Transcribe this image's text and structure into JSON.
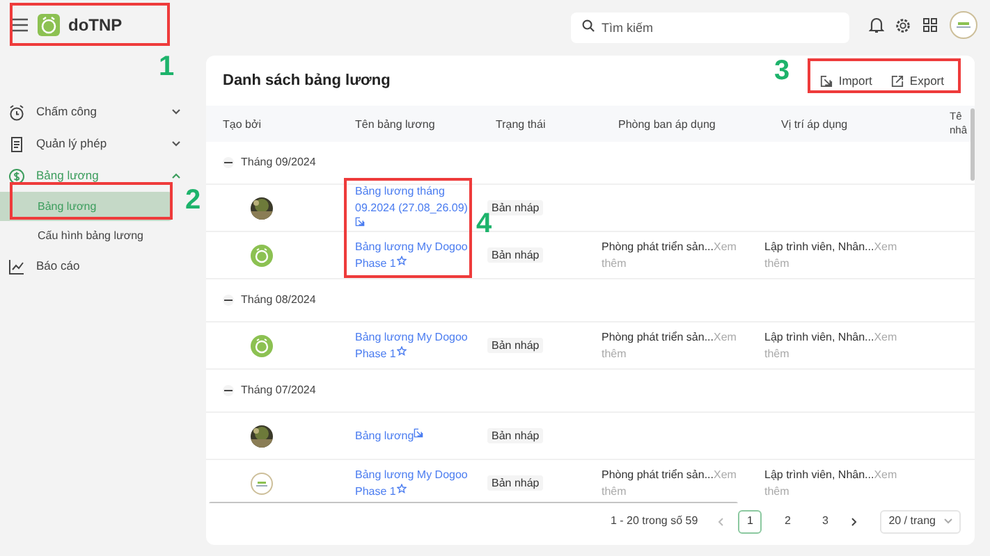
{
  "app": {
    "name": "doTNP"
  },
  "search": {
    "placeholder": "Tìm kiếm"
  },
  "sidebar": {
    "items": [
      {
        "label": "Chấm công",
        "kind": "clock",
        "expanded": false
      },
      {
        "label": "Quản lý phép",
        "kind": "document",
        "expanded": false
      },
      {
        "label": "Bảng lương",
        "kind": "dollar",
        "expanded": true,
        "children": [
          {
            "label": "Bảng lương",
            "selected": true
          },
          {
            "label": "Cấu hình bảng lương",
            "selected": false
          }
        ]
      },
      {
        "label": "Báo cáo",
        "kind": "chart"
      }
    ]
  },
  "panel": {
    "title": "Danh sách bảng lương",
    "actions": [
      {
        "label": "Import",
        "kind": "import"
      },
      {
        "label": "Export",
        "kind": "export"
      }
    ]
  },
  "table": {
    "columns": [
      "Tạo bởi",
      "Tên bảng lương",
      "Trạng thái",
      "Phòng ban áp dụng",
      "Vị trí áp dụng",
      "Tê nhâ"
    ],
    "groups": [
      {
        "label": "Tháng 09/2024",
        "expanded": true,
        "rows": [
          {
            "name": "Bảng lương tháng 09.2024 (27.08_26.09)",
            "status": "Bản nháp"
          },
          {
            "kind": "logo",
            "name": "Bảng lương My Dogoo Phase 1",
            "status": "Bản nháp",
            "department": "Phòng phát triển sản...",
            "department_more": "Xem thêm",
            "position": "Lập trình viên, Nhân...",
            "position_more": "Xem thêm"
          }
        ]
      },
      {
        "label": "Tháng 08/2024",
        "expanded": true,
        "rows": [
          {
            "kind": "logo",
            "name": "Bảng lương My Dogoo Phase 1",
            "status": "Bản nháp",
            "department": "Phòng phát triển sản...",
            "department_more": "Xem thêm",
            "position": "Lập trình viên, Nhân...",
            "position_more": "Xem thêm"
          }
        ]
      },
      {
        "label": "Tháng 07/2024",
        "expanded": true,
        "rows": [
          {
            "name": "Bảng lương",
            "status": "Bản nháp"
          },
          {
            "kind": "badge",
            "name": "Bảng lương My Dogoo Phase 1",
            "status": "Bản nháp",
            "department": "Phòng phát triển sản...",
            "department_more": "Xem thêm",
            "position": "Lập trình viên, Nhân...",
            "position_more": "Xem thêm"
          }
        ]
      }
    ]
  },
  "pagination": {
    "summary": "1 - 20 trong số 59",
    "pages": [
      {
        "label": "1",
        "selected": true
      },
      {
        "label": "2",
        "selected": false
      },
      {
        "label": "3",
        "selected": false
      }
    ],
    "page_size": "20 / trang"
  },
  "annotations": [
    {
      "number": "1"
    },
    {
      "number": "2"
    },
    {
      "number": "3"
    },
    {
      "number": "4"
    }
  ]
}
